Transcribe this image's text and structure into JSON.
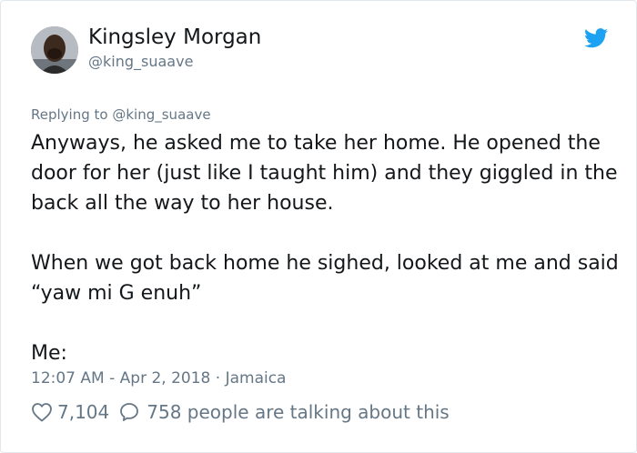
{
  "author": {
    "display_name": "Kingsley Morgan",
    "handle": "@king_suaave",
    "avatar_icon": "avatar-photo"
  },
  "reply_context": {
    "prefix": "Replying to",
    "mention": "@king_suaave"
  },
  "tweet": {
    "paragraphs": [
      "Anyways, he asked me to take her home. He opened the door for her (just like I taught him) and they giggled in the back all the way to her house.",
      "When we got back home he sighed, looked at me and said “yaw mi G enuh”",
      "Me:"
    ]
  },
  "meta": {
    "time": "12:07 AM",
    "separator": "-",
    "date": "Apr 2, 2018",
    "dot": "·",
    "location": "Jamaica"
  },
  "stats": {
    "likes": "7,104",
    "talking": "758 people are talking about this"
  },
  "colors": {
    "twitter_blue": "#1da1f2",
    "text": "#14171a",
    "muted": "#657786",
    "border": "#e1e8ed"
  },
  "icons": {
    "brand": "twitter-bird-icon",
    "like": "heart-icon",
    "comment": "comment-icon"
  }
}
